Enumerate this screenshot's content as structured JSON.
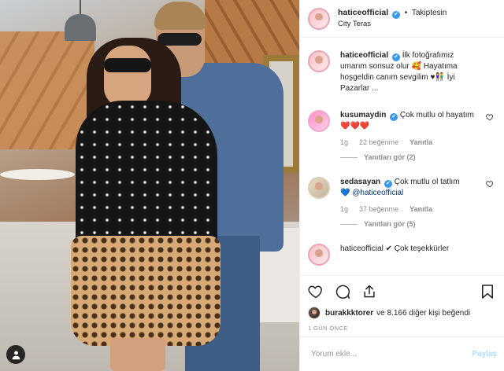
{
  "header": {
    "username": "haticeofficial",
    "verified_icon": "✔",
    "separator": "•",
    "follow_status": "Takiptesin",
    "location": "City Teras"
  },
  "caption": {
    "username": "haticeofficial",
    "text": "İlk fotoğrafımız umarım sonsuz olur 🥰 Hayatıma hoşgeldin canım sevgilim ♥👫 İyi Pazarlar ..."
  },
  "comments": [
    {
      "username": "kusumaydin",
      "text": "Çok mutlu ol hayatım❤️❤️❤️",
      "time": "1g",
      "likes": "22 beğenme",
      "reply_label": "Yanıtla",
      "view_replies": "Yanıtları gör (2)"
    },
    {
      "username": "sedasayan",
      "text": "Çok mutlu ol tatlım",
      "heart": "💙",
      "mention": "@haticeofficial",
      "time": "1g",
      "likes": "37 beğenme",
      "reply_label": "Yanıtla",
      "view_replies": "Yanıtları gör (5)"
    }
  ],
  "partial_comment": {
    "text": "haticeofficial ✔ Çok teşekkürler"
  },
  "likes": {
    "user": "burakkktorer",
    "rest": "ve 8.166 diğer kişi beğendi"
  },
  "timestamp": "1 GÜN ÖNCE",
  "add_comment": {
    "placeholder": "Yorum ekle...",
    "post_label": "Paylaş"
  },
  "icons": [
    "heart-icon",
    "comment-icon",
    "share-icon",
    "bookmark-icon",
    "user-tag-icon"
  ]
}
